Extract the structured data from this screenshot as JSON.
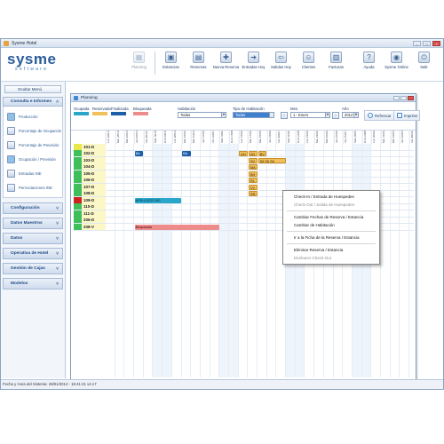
{
  "window": {
    "title": "Sysme Hotel"
  },
  "brand": {
    "name": "sysme",
    "tagline": "software"
  },
  "toolbar": [
    {
      "label": "Planning",
      "icon": "calendar-icon",
      "disabled": true,
      "glyph": "▦"
    },
    {
      "label": "Estancias",
      "icon": "bed-icon",
      "disabled": false,
      "glyph": "▣"
    },
    {
      "label": "Reservas",
      "icon": "reservation-icon",
      "disabled": false,
      "glyph": "▤"
    },
    {
      "label": "Nueva Reserva",
      "icon": "new-reservation-icon",
      "disabled": false,
      "glyph": "✚"
    },
    {
      "label": "Entradas Hoy",
      "icon": "arrivals-icon",
      "disabled": false,
      "glyph": "➜"
    },
    {
      "label": "Salidas Hoy",
      "icon": "departures-icon",
      "disabled": false,
      "glyph": "⇦"
    },
    {
      "label": "Clientes",
      "icon": "clients-icon",
      "disabled": false,
      "glyph": "☺"
    },
    {
      "label": "Facturas",
      "icon": "invoice-icon",
      "disabled": false,
      "glyph": "▥"
    }
  ],
  "toolbar_right": [
    {
      "label": "Ayuda",
      "icon": "help-icon",
      "glyph": "?"
    },
    {
      "label": "Sysme Online",
      "icon": "online-icon",
      "glyph": "◉"
    },
    {
      "label": "Salir",
      "icon": "exit-icon",
      "glyph": "⏻"
    }
  ],
  "sidebar": {
    "hide_menu": "Ocultar Menú",
    "consulta": {
      "title": "Consulta e Informes",
      "items": [
        "Producción",
        "Porcentaje de Ocupación",
        "Porcentaje de Previsión",
        "Ocupación / Previsión",
        "Entradas INE",
        "Pernoctaciones INE"
      ]
    },
    "sections": [
      "Configuración",
      "Datos Maestros",
      "Datos",
      "Operativa de Hotel",
      "Gestión de Cajas",
      "Modelos"
    ]
  },
  "planning": {
    "title": "Planning",
    "legend": [
      {
        "label": "Ocupada",
        "color": "#29a6c9"
      },
      {
        "label": "Reservada",
        "color": "#f2c05a"
      },
      {
        "label": "Finalizada",
        "color": "#1c5fa8"
      },
      {
        "label": "Bloqueada",
        "color": "#ee8b8b"
      }
    ],
    "habitacion_label": "Habitación",
    "habitacion_value": "Todas",
    "tipo_label": "Tipo de Habitación",
    "tipo_value": "Todas",
    "mes_label": "Mes",
    "mes_value": "1 - Enero",
    "anio_label": "Año",
    "anio_value": "2012",
    "refrescar": "Refrescar",
    "imprimir": "Imprimir",
    "days": [
      "Lun 2/01/12",
      "Mar 3/01/12",
      "Mié 4/01/12",
      "Jue 5/01/12",
      "Vie 6/01/12",
      "Sáb 7/01/12",
      "Dom 8/01/12",
      "Lun 9/01/12",
      "Mar 10/01/12",
      "Mié 11/01/12",
      "Jue 12/01/12",
      "Vie 13/01/12",
      "Sáb 14/01/12",
      "Dom 15/01/12",
      "Lun 16/01/12",
      "Mar 17/01/12",
      "Mié 18/01/12",
      "Jue 19/01/12",
      "Vie 20/01/12",
      "Sáb 21/01/12",
      "Dom 22/01/12",
      "Lun 23/01/12",
      "Mar 24/01/12",
      "Mié 25/01/12",
      "Jue 26/01/12",
      "Vie 27/01/12",
      "Sáb 28/01/12",
      "Dom 29/01/12",
      "Lun 30/01/12",
      "Mar 31/01/12",
      "Mié 1/02/12",
      "Jue 2/02/12",
      "Vie 3/02/12"
    ],
    "rooms": [
      {
        "name": "101-D",
        "color": "#e8e84a"
      },
      {
        "name": "102-D",
        "color": "#3fbf5a"
      },
      {
        "name": "103-D",
        "color": "#3fbf5a"
      },
      {
        "name": "104-D",
        "color": "#3fbf5a"
      },
      {
        "name": "105-D",
        "color": "#3fbf5a"
      },
      {
        "name": "106-D",
        "color": "#3fbf5a"
      },
      {
        "name": "107-D",
        "color": "#3fbf5a"
      },
      {
        "name": "108-D",
        "color": "#3fbf5a"
      },
      {
        "name": "109-D",
        "color": "#d02020"
      },
      {
        "name": "110-D",
        "color": "#3fbf5a"
      },
      {
        "name": "111-D",
        "color": "#3fbf5a"
      },
      {
        "name": "206-D",
        "color": "#3fbf5a"
      },
      {
        "name": "208-V",
        "color": "#3fbf5a"
      }
    ],
    "bookings": [
      {
        "row": 1,
        "start": 3,
        "len": 1,
        "type": "fin",
        "label": "BA"
      },
      {
        "row": 1,
        "start": 8,
        "len": 1,
        "type": "fin",
        "label": "BA"
      },
      {
        "row": 1,
        "start": 14,
        "len": 1,
        "type": "res",
        "label": "AH"
      },
      {
        "row": 1,
        "start": 15,
        "len": 1,
        "type": "res",
        "label": "AH"
      },
      {
        "row": 1,
        "start": 16,
        "len": 1,
        "type": "res",
        "label": "BV"
      },
      {
        "row": 2,
        "start": 15,
        "len": 1,
        "type": "res",
        "label": "SV"
      },
      {
        "row": 2,
        "start": 16,
        "len": 3,
        "type": "res",
        "label": "S6 S6 S6"
      },
      {
        "row": 3,
        "start": 15,
        "len": 1,
        "type": "res",
        "label": "MA"
      },
      {
        "row": 4,
        "start": 15,
        "len": 1,
        "type": "res",
        "label": "BH"
      },
      {
        "row": 5,
        "start": 15,
        "len": 1,
        "type": "res",
        "label": "RL"
      },
      {
        "row": 6,
        "start": 15,
        "len": 1,
        "type": "res",
        "label": "VV"
      },
      {
        "row": 7,
        "start": 15,
        "len": 1,
        "type": "res",
        "label": "RR"
      },
      {
        "row": 8,
        "start": 3,
        "len": 5,
        "type": "ocu",
        "label": "APELLIDOS NO"
      },
      {
        "row": 12,
        "start": 3,
        "len": 9,
        "type": "blq",
        "label": "Bloqueada"
      }
    ],
    "context_menu": [
      {
        "label": "Check-In / Entrada de Huespedes",
        "disabled": false
      },
      {
        "label": "Check-Out / Salida de Huespedes",
        "disabled": true
      },
      {
        "sep": true
      },
      {
        "label": "Cambiar Fechas de Reserva / Estancia",
        "disabled": false
      },
      {
        "label": "Cambiar de Habitación",
        "disabled": false
      },
      {
        "sep": true
      },
      {
        "label": "Ir a la Ficha de la Reserva / Estancia",
        "disabled": false
      },
      {
        "sep": true
      },
      {
        "label": "Eliminar Reserva / Estancia",
        "disabled": false
      },
      {
        "label": "Deshacer Check-Out",
        "disabled": true
      }
    ]
  },
  "status": {
    "text": "Fecha y Hora del Sistema: 28/01/2012 - 16:41:21 v4.17"
  }
}
